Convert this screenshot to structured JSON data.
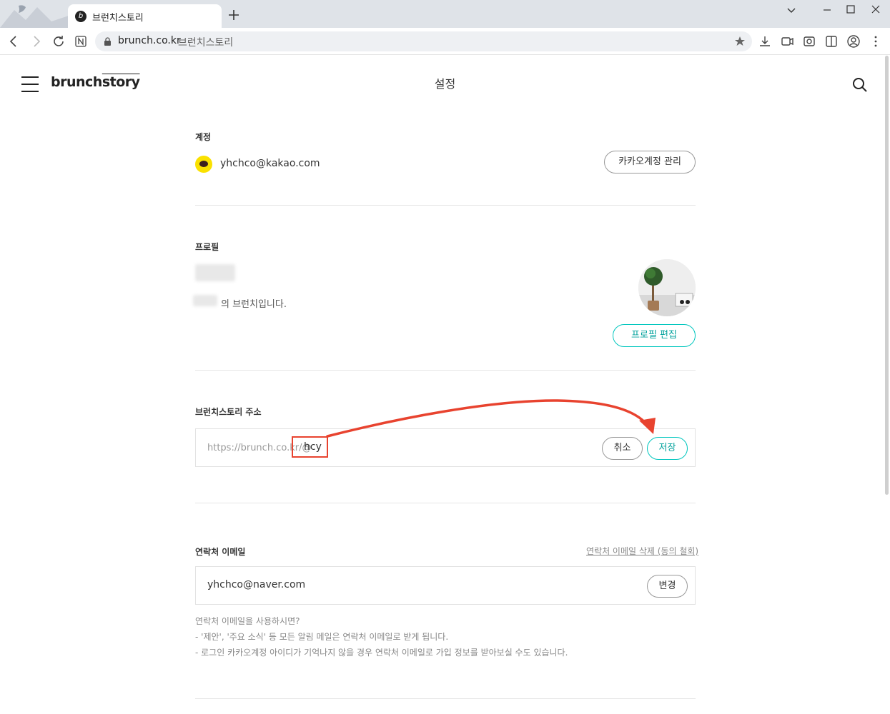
{
  "browser": {
    "tab_title": "브런치스토리",
    "tab_favicon": "b",
    "url_host": "brunch.co.kr",
    "url_title": "브런치스토리",
    "icons": [
      "back-icon",
      "forward-icon",
      "reload-icon",
      "n-extension-icon",
      "lock-icon",
      "star-icon",
      "download-icon",
      "tab-capture-icon",
      "screenshot-icon",
      "sidebar-icon",
      "profile-icon",
      "more-icon"
    ]
  },
  "header": {
    "logo_brunch": "brunch",
    "logo_story": "story",
    "page_title": "설정"
  },
  "account": {
    "label": "계정",
    "email": "yhchco@kakao.com",
    "manage_button": "카카오계정 관리"
  },
  "profile": {
    "label": "프로필",
    "description": "의 브런치입니다.",
    "edit_button": "프로필 편집"
  },
  "address": {
    "label": "브런치스토리 주소",
    "prefix": "https://brunch.co.kr/@",
    "id_value": "hcy",
    "cancel_button": "취소",
    "save_button": "저장"
  },
  "contact": {
    "label": "연락처 이메일",
    "delete_link": "연락처 이메일 삭제 (동의 철회)",
    "email": "yhchco@naver.com",
    "change_button": "변경",
    "notice_title": "연락처 이메일을 사용하시면?",
    "notice_line1": "- '제안', '주요 소식' 등 모든 알림 메일은 연락처 이메일로 받게 됩니다.",
    "notice_line2": "- 로그인 카카오계정 아이디가 기억나지 않을 경우 연락처 이메일로 가입 정보를 받아보실 수도 있습니다."
  },
  "colors": {
    "accent_mint": "#00c6be",
    "annotation_red": "#e8432f",
    "kakao_yellow": "#fae100"
  }
}
